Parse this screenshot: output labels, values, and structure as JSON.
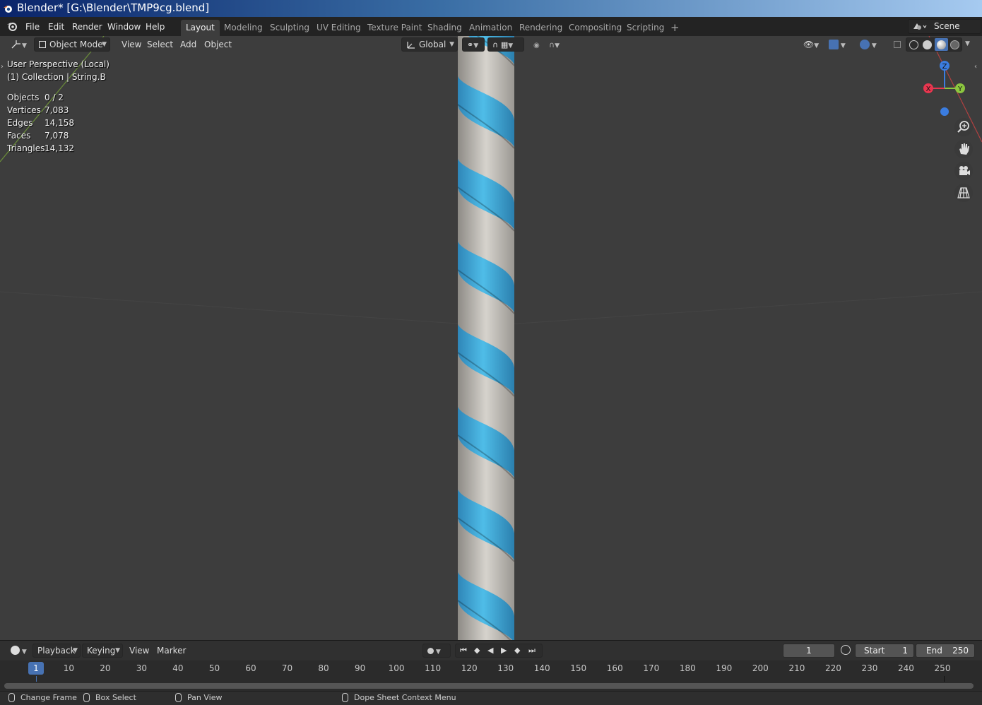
{
  "title_bar": {
    "title": "Blender* [G:\\Blender\\TMP9cg.blend]"
  },
  "menu": {
    "file": "File",
    "edit": "Edit",
    "render": "Render",
    "window": "Window",
    "help": "Help"
  },
  "workspaces": [
    "Layout",
    "Modeling",
    "Sculpting",
    "UV Editing",
    "Texture Paint",
    "Shading",
    "Animation",
    "Rendering",
    "Compositing",
    "Scripting"
  ],
  "workspace_add": "+",
  "scene": "Scene",
  "viewport_header": {
    "mode": "Object Mode",
    "view": "View",
    "select": "Select",
    "add": "Add",
    "object": "Object",
    "orientation": "Global"
  },
  "viewport_overlay": {
    "perspective": "User Perspective (Local)",
    "collection": "(1) Collection | String.B"
  },
  "stats": {
    "objects_label": "Objects",
    "objects": "0 / 2",
    "vertices_label": "Vertices",
    "vertices": "7,083",
    "edges_label": "Edges",
    "edges": "14,158",
    "faces_label": "Faces",
    "faces": "7,078",
    "triangles_label": "Triangles",
    "triangles": "14,132"
  },
  "gizmo": {
    "z": "Z",
    "x": "X",
    "y": "Y"
  },
  "colors": {
    "accent": "#4772b3",
    "axis_x": "#e8364f",
    "axis_y": "#8cc63f",
    "axis_z": "#3b7de0",
    "rope_blue": "#3aa8d8",
    "rope_white": "#c9c6c0"
  },
  "timeline": {
    "playback": "Playback",
    "keying": "Keying",
    "view": "View",
    "marker": "Marker",
    "current_frame": "1",
    "start_label": "Start",
    "start": "1",
    "end_label": "End",
    "end": "250",
    "ruler": [
      "10",
      "20",
      "30",
      "40",
      "50",
      "60",
      "70",
      "80",
      "90",
      "100",
      "110",
      "120",
      "130",
      "140",
      "150",
      "160",
      "170",
      "180",
      "190",
      "200",
      "210",
      "220",
      "230",
      "240",
      "250"
    ],
    "playhead": "1"
  },
  "status": {
    "change_frame": "Change Frame",
    "box_select": "Box Select",
    "pan_view": "Pan View",
    "context_menu": "Dope Sheet Context Menu"
  }
}
